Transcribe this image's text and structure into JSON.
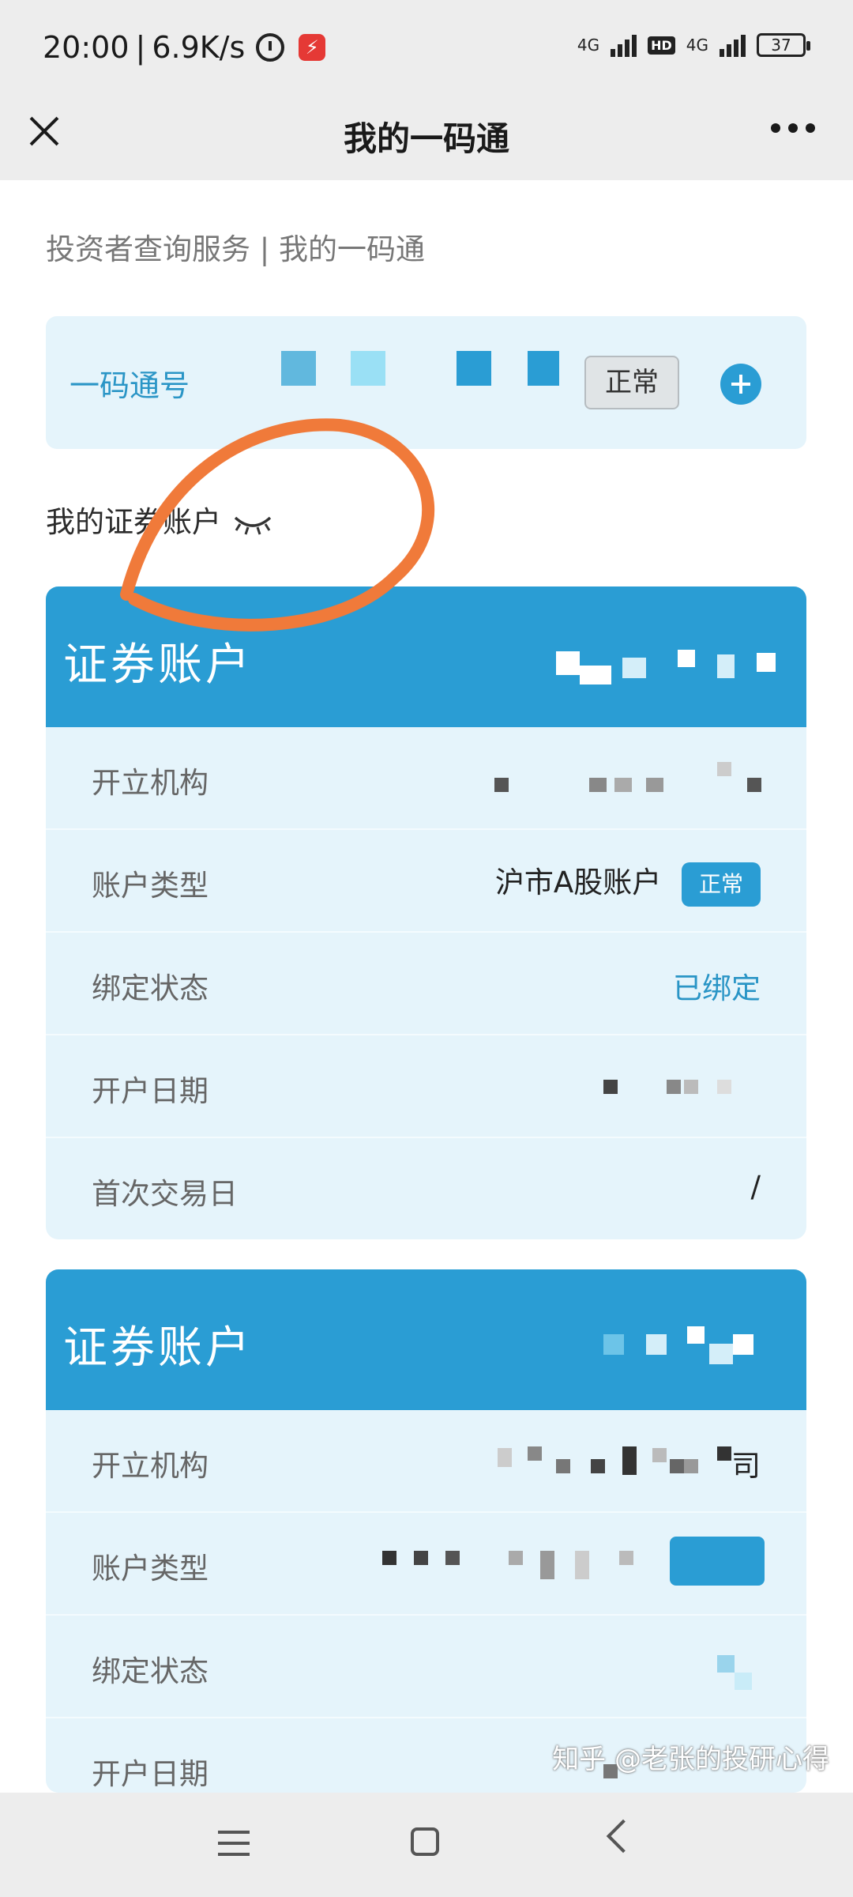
{
  "status_bar": {
    "time": "20:00",
    "network_speed": "6.9K/s",
    "signal_1": "4G",
    "hd": "HD",
    "signal_2": "4G",
    "battery": "37"
  },
  "nav": {
    "title": "我的一码通"
  },
  "breadcrumb": "投资者查询服务 | 我的一码通",
  "code_card": {
    "label": "一码通号",
    "status": "正常"
  },
  "section": {
    "title": "我的证券账户"
  },
  "accounts": [
    {
      "header": "证券账户",
      "rows": [
        {
          "label": "开立机构",
          "value": ""
        },
        {
          "label": "账户类型",
          "value": "沪市A股账户",
          "badge": "正常"
        },
        {
          "label": "绑定状态",
          "value": "已绑定"
        },
        {
          "label": "开户日期",
          "value": ""
        },
        {
          "label": "首次交易日",
          "value": "/"
        }
      ]
    },
    {
      "header": "证券账户",
      "rows": [
        {
          "label": "开立机构",
          "value": "司"
        },
        {
          "label": "账户类型",
          "value": ""
        },
        {
          "label": "绑定状态",
          "value": ""
        },
        {
          "label": "开户日期",
          "value": ""
        }
      ]
    }
  ],
  "watermark": "知乎 @老张的投研心得",
  "colors": {
    "accent": "#2a9dd4",
    "card_bg": "#e5f4fb",
    "annotation": "#f07a3a"
  }
}
